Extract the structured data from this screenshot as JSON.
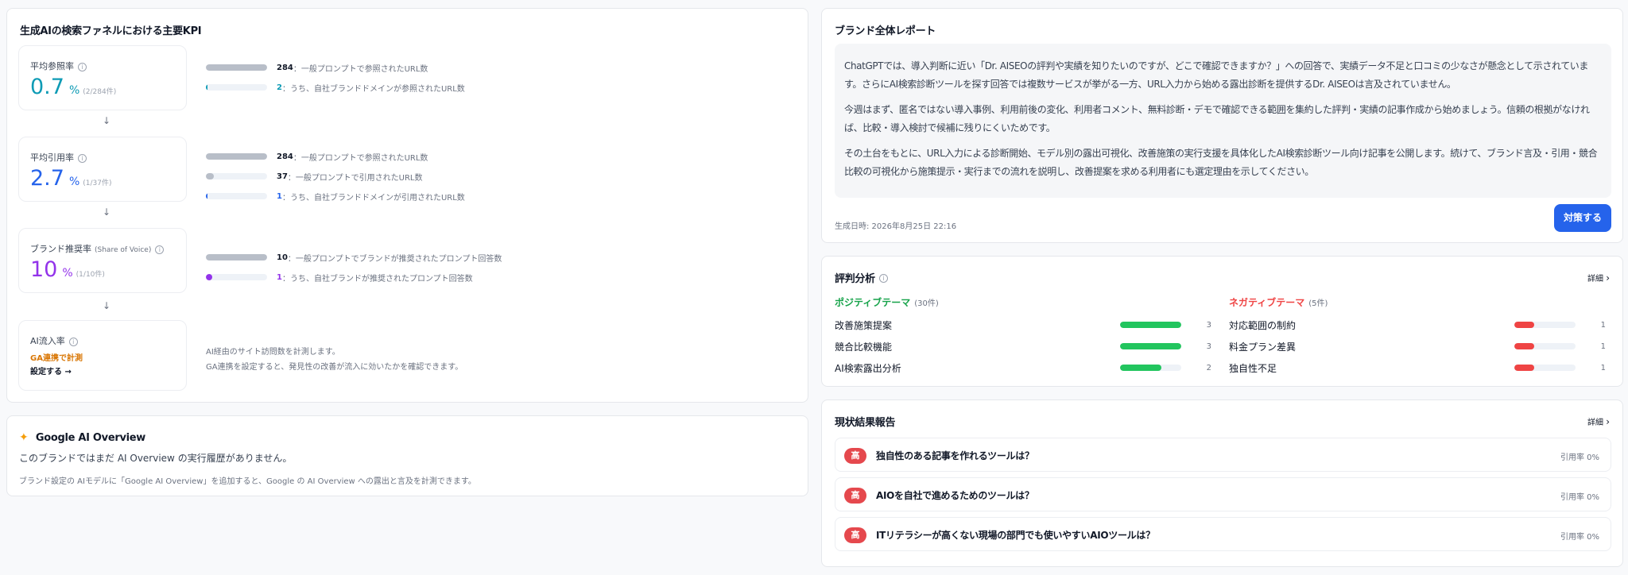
{
  "kpi": {
    "title": "生成AIの検索ファネルにおける主要KPI",
    "ref": {
      "label": "平均参照率",
      "value": "0.7",
      "unit": "%",
      "sub": "(2/284件)",
      "bars": [
        {
          "num": "284",
          "desc": "：一般プロンプトで参照されたURL数",
          "fill": 1.0
        },
        {
          "num": "2",
          "desc": "：うち、自社ブランドドメインが参照されたURL数",
          "fill": 0.007
        }
      ]
    },
    "cite": {
      "label": "平均引用率",
      "value": "2.7",
      "unit": "%",
      "sub": "(1/37件)",
      "bars": [
        {
          "num": "284",
          "desc": "：一般プロンプトで参照されたURL数",
          "fill": 1.0
        },
        {
          "num": "37",
          "desc": "：一般プロンプトで引用されたURL数",
          "fill": 0.13
        },
        {
          "num": "1",
          "desc": "：うち、自社ブランドドメインが引用されたURL数",
          "fill": 0.0035
        }
      ]
    },
    "sov": {
      "label": "ブランド推奨率",
      "label_sub": "(Share of Voice)",
      "value": "10",
      "unit": "%",
      "sub": "(1/10件)",
      "bars": [
        {
          "num": "10",
          "desc": "：一般プロンプトでブランドが推奨されたプロンプト回答数",
          "fill": 1.0
        },
        {
          "num": "1",
          "desc": "：うち、自社ブランドが推奨されたプロンプト回答数",
          "fill": 0.1
        }
      ]
    },
    "inflow": {
      "label": "AI流入率",
      "status": "GA連携で計測",
      "link": "設定する →",
      "note1": "AI経由のサイト訪問数を計測します。",
      "note2": "GA連携を設定すると、発見性の改善が流入に効いたかを確認できます。"
    },
    "colors": {
      "ref": "#0e9bb5",
      "cite": "#2563eb",
      "sov": "#9333ea",
      "bar_gray": "#b8bec8"
    }
  },
  "aio": {
    "title": "Google AI Overview",
    "msg": "このブランドではまだ AI Overview の実行履歴がありません。",
    "note": "ブランド設定の AIモデルに「Google AI Overview」を追加すると、Google の AI Overview への露出と言及を計測できます。"
  },
  "report": {
    "title": "ブランド全体レポート",
    "p1": "ChatGPTでは、導入判断に近い「Dr. AISEOの評判や実績を知りたいのですが、どこで確認できますか？」への回答で、実績データ不足と口コミの少なさが懸念として示されています。さらにAI検索診断ツールを探す回答では複数サービスが挙がる一方、URL入力から始める露出診断を提供するDr. AISEOは言及されていません。",
    "p2": "今週はまず、匿名ではない導入事例、利用前後の変化、利用者コメント、無料診断・デモで確認できる範囲を集約した評判・実績の記事作成から始めましょう。信頼の根拠がなければ、比較・導入検討で候補に残りにくいためです。",
    "p3": "その土台をもとに、URL入力による診断開始、モデル別の露出可視化、改善施策の実行支援を具体化したAI検索診断ツール向け記事を公開します。続けて、ブランド言及・引用・競合比較の可視化から施策提示・実行までの流れを説明し、改善提案を求める利用者にも選定理由を示してください。",
    "generated": "生成日時: 2026年8月25日 22:16",
    "button": "対策する"
  },
  "reputation": {
    "title": "評判分析",
    "detail": "詳細",
    "positive": {
      "label": "ポジティブテーマ",
      "count": "(30件)",
      "color": "#16a34a",
      "items": [
        {
          "label": "改善施策提案",
          "count": "3",
          "fill": 1.0
        },
        {
          "label": "競合比較機能",
          "count": "3",
          "fill": 1.0
        },
        {
          "label": "AI検索露出分析",
          "count": "2",
          "fill": 0.67
        }
      ]
    },
    "negative": {
      "label": "ネガティブテーマ",
      "count": "(5件)",
      "color": "#ef4444",
      "items": [
        {
          "label": "対応範囲の制約",
          "count": "1",
          "fill": 0.33
        },
        {
          "label": "料金プラン差異",
          "count": "1",
          "fill": 0.33
        },
        {
          "label": "独自性不足",
          "count": "1",
          "fill": 0.33
        }
      ]
    }
  },
  "status": {
    "title": "現状結果報告",
    "detail": "詳細",
    "items": [
      {
        "priority": "高",
        "text": "独自性のある記事を作れるツールは？",
        "rate": "引用率 0%"
      },
      {
        "priority": "高",
        "text": "AIOを自社で進めるためのツールは？",
        "rate": "引用率 0%"
      },
      {
        "priority": "高",
        "text": "ITリテラシーが高くない現場の部門でも使いやすいAIOツールは？",
        "rate": "引用率 0%"
      }
    ]
  }
}
